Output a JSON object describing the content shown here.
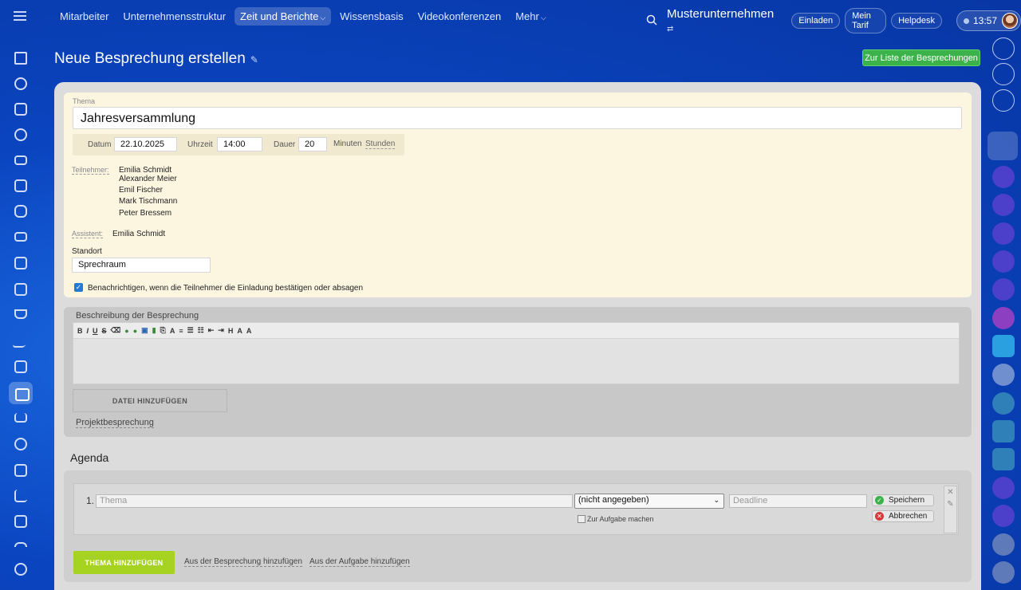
{
  "nav": {
    "items": [
      "Mitarbeiter",
      "Unternehmensstruktur",
      "Zeit und Berichte",
      "Wissensbasis",
      "Videokonferenzen",
      "Mehr"
    ],
    "company": "Musterunternehmen",
    "invite": "Einladen",
    "tariff": "Mein Tarif",
    "helpdesk": "Helpdesk",
    "time": "13:57"
  },
  "page": {
    "title": "Neue Besprechung erstellen",
    "list_button": "Zur Liste der Besprechungen"
  },
  "form": {
    "theme_label": "Thema",
    "theme_value": "Jahresversammlung",
    "date_label": "Datum",
    "date_value": "22.10.2025",
    "time_label": "Uhrzeit",
    "time_value": "14:00",
    "duration_label": "Dauer",
    "duration_value": "20",
    "minutes": "Minuten",
    "hours": "Stunden",
    "participants_label": "Teilnehmer:",
    "participants": [
      "Emilia Schmidt",
      "Alexander Meier",
      "Emil Fischer",
      "Mark Tischmann",
      "Peter Bressem"
    ],
    "assistant_label": "Assistent:",
    "assistant_value": "Emilia Schmidt",
    "location_label": "Standort",
    "location_value": "Sprechraum",
    "notify_label": "Benachrichtigen, wenn die Teilnehmer die Einladung bestätigen oder absagen"
  },
  "description": {
    "label": "Beschreibung der Besprechung",
    "toolbar": [
      "B",
      "I",
      "U",
      "S"
    ],
    "file_button": "DATEI HINZUFÜGEN",
    "project_link": "Projektbesprechung"
  },
  "agenda": {
    "title": "Agenda",
    "item_number": "1.",
    "theme_placeholder": "Thema",
    "select_value": "(nicht angegeben)",
    "deadline_placeholder": "Deadline",
    "task_checkbox": "Zur Aufgabe machen",
    "save": "Speichern",
    "cancel": "Abbrechen",
    "add_button": "THEMA HINZUFÜGEN",
    "from_meeting": "Aus der Besprechung hinzufügen",
    "from_task": "Aus der Aufgabe hinzufügen"
  },
  "colors": {
    "primary_bg": "#0a44bf",
    "form_bg": "#fcf6e1",
    "green_button": "#3bb24a",
    "lime_button": "#a6d321"
  }
}
